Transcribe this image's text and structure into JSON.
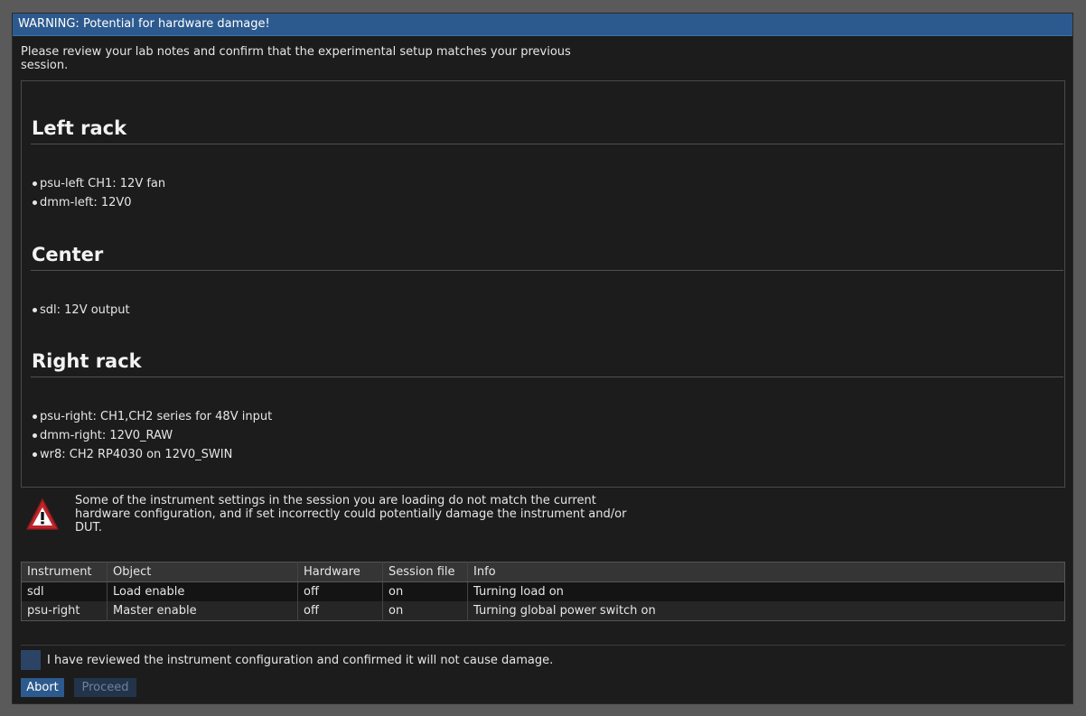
{
  "dialog": {
    "title": "WARNING: Potential for hardware damage!",
    "intro": "Please review your lab notes and confirm that the experimental setup matches your previous session."
  },
  "notes": {
    "sections": [
      {
        "heading": "Left rack",
        "items": [
          "psu-left CH1: 12V fan",
          "dmm-left: 12V0"
        ]
      },
      {
        "heading": "Center",
        "items": [
          "sdl: 12V output"
        ]
      },
      {
        "heading": "Right rack",
        "items": [
          "psu-right: CH1,CH2 series for 48V input",
          "dmm-right: 12V0_RAW",
          "wr8: CH2 RP4030 on 12V0_SWIN"
        ]
      }
    ]
  },
  "warning": {
    "icon": "warning-triangle-icon",
    "text": "Some of the instrument settings in the session you are loading do not match the current hardware configuration, and if set incorrectly could potentially damage the instrument and/or DUT."
  },
  "table": {
    "headers": [
      "Instrument",
      "Object",
      "Hardware",
      "Session file",
      "Info"
    ],
    "rows": [
      [
        "sdl",
        "Load enable",
        "off",
        "on",
        "Turning load on"
      ],
      [
        "psu-right",
        "Master enable",
        "off",
        "on",
        "Turning global power switch on"
      ]
    ]
  },
  "confirm": {
    "checked": false,
    "label": "I have reviewed the instrument configuration and confirmed it will not cause damage."
  },
  "buttons": {
    "abort": "Abort",
    "proceed": "Proceed"
  },
  "colors": {
    "titlebar": "#2d5a8e",
    "background": "#1c1c1c",
    "warning_red": "#c0262c"
  }
}
